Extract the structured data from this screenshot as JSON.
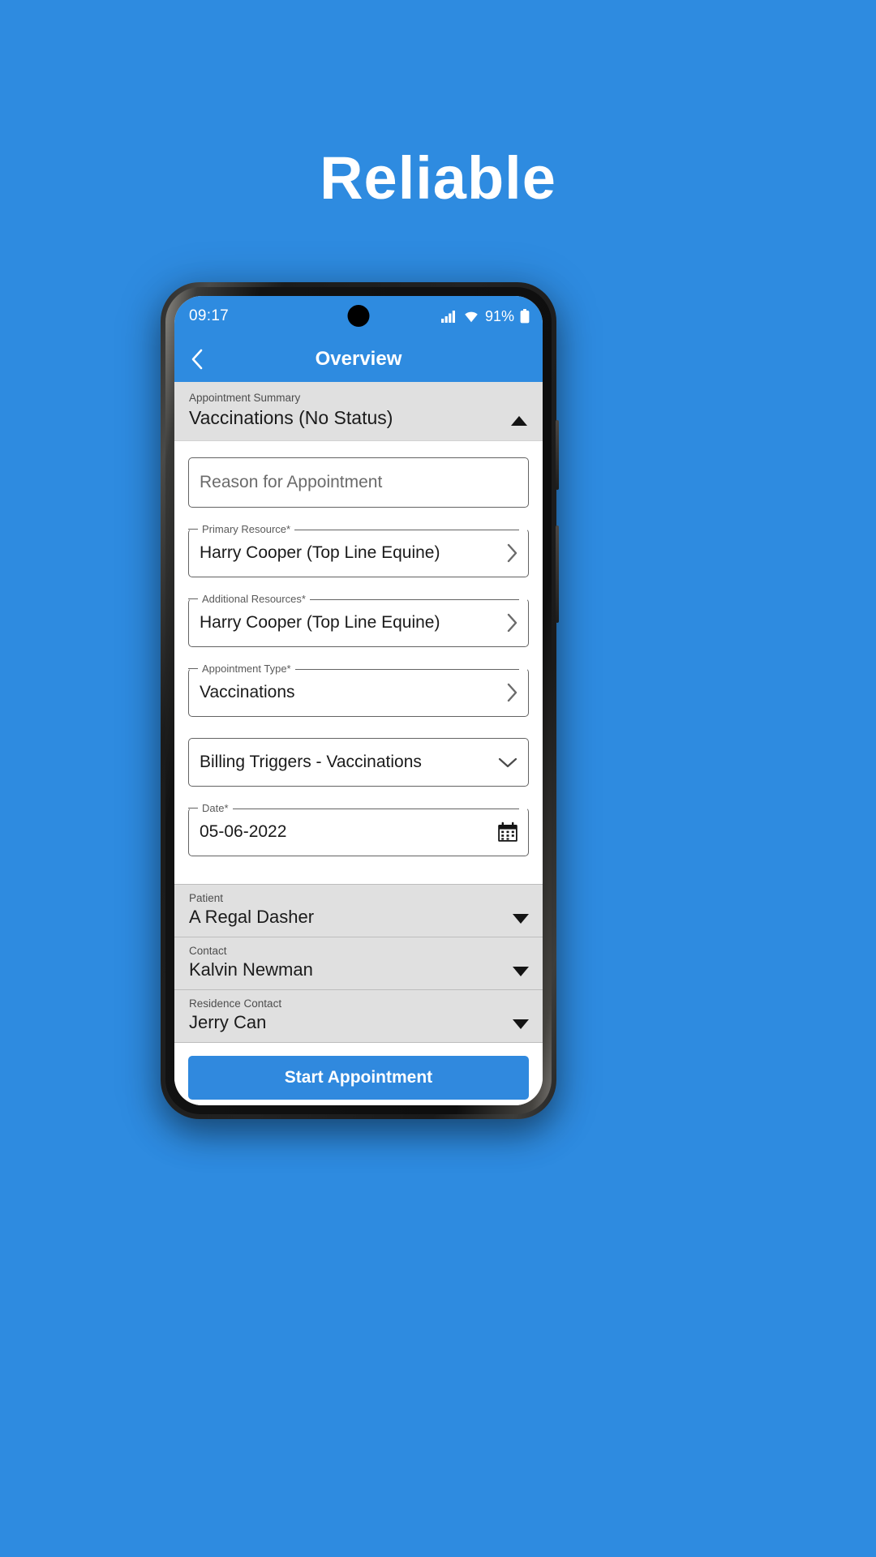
{
  "page": {
    "headline": "Reliable",
    "background_color": "#2E8BE0",
    "accent_color": "#3089DE"
  },
  "status_bar": {
    "time": "09:17",
    "battery_percent": "91%",
    "icons": [
      "signal-bars-icon",
      "wifi-icon",
      "battery-icon"
    ]
  },
  "nav_bar": {
    "back_icon": "chevron-left-icon",
    "title": "Overview"
  },
  "summary": {
    "label": "Appointment Summary",
    "value": "Vaccinations (No Status)",
    "collapse_icon": "triangle-up-icon"
  },
  "form": {
    "fields": [
      {
        "name": "reason-for-appointment",
        "label": "",
        "value": "Reason for Appointment",
        "is_placeholder": true,
        "trailing_icon": ""
      },
      {
        "name": "primary-resource",
        "label": "Primary Resource*",
        "value": "Harry Cooper (Top Line Equine)",
        "is_placeholder": false,
        "trailing_icon": "chevron-right-icon"
      },
      {
        "name": "additional-resources",
        "label": "Additional Resources*",
        "value": "Harry Cooper (Top Line Equine)",
        "is_placeholder": false,
        "trailing_icon": "chevron-right-icon"
      },
      {
        "name": "appointment-type",
        "label": "Appointment Type*",
        "value": "Vaccinations",
        "is_placeholder": false,
        "trailing_icon": "chevron-right-icon"
      },
      {
        "name": "billing-triggers",
        "label": "",
        "value": "Billing Triggers - Vaccinations",
        "is_placeholder": false,
        "trailing_icon": "chevron-down-icon"
      },
      {
        "name": "date",
        "label": "Date*",
        "value": "05-06-2022",
        "is_placeholder": false,
        "trailing_icon": "calendar-icon"
      }
    ]
  },
  "select_rows": [
    {
      "name": "patient",
      "label": "Patient",
      "value": "A Regal Dasher",
      "icon": "caret-down-icon"
    },
    {
      "name": "contact",
      "label": "Contact",
      "value": "Kalvin Newman",
      "icon": "caret-down-icon"
    },
    {
      "name": "residence-contact",
      "label": "Residence Contact",
      "value": "Jerry  Can",
      "icon": "caret-down-icon"
    }
  ],
  "cta": {
    "label": "Start Appointment"
  }
}
